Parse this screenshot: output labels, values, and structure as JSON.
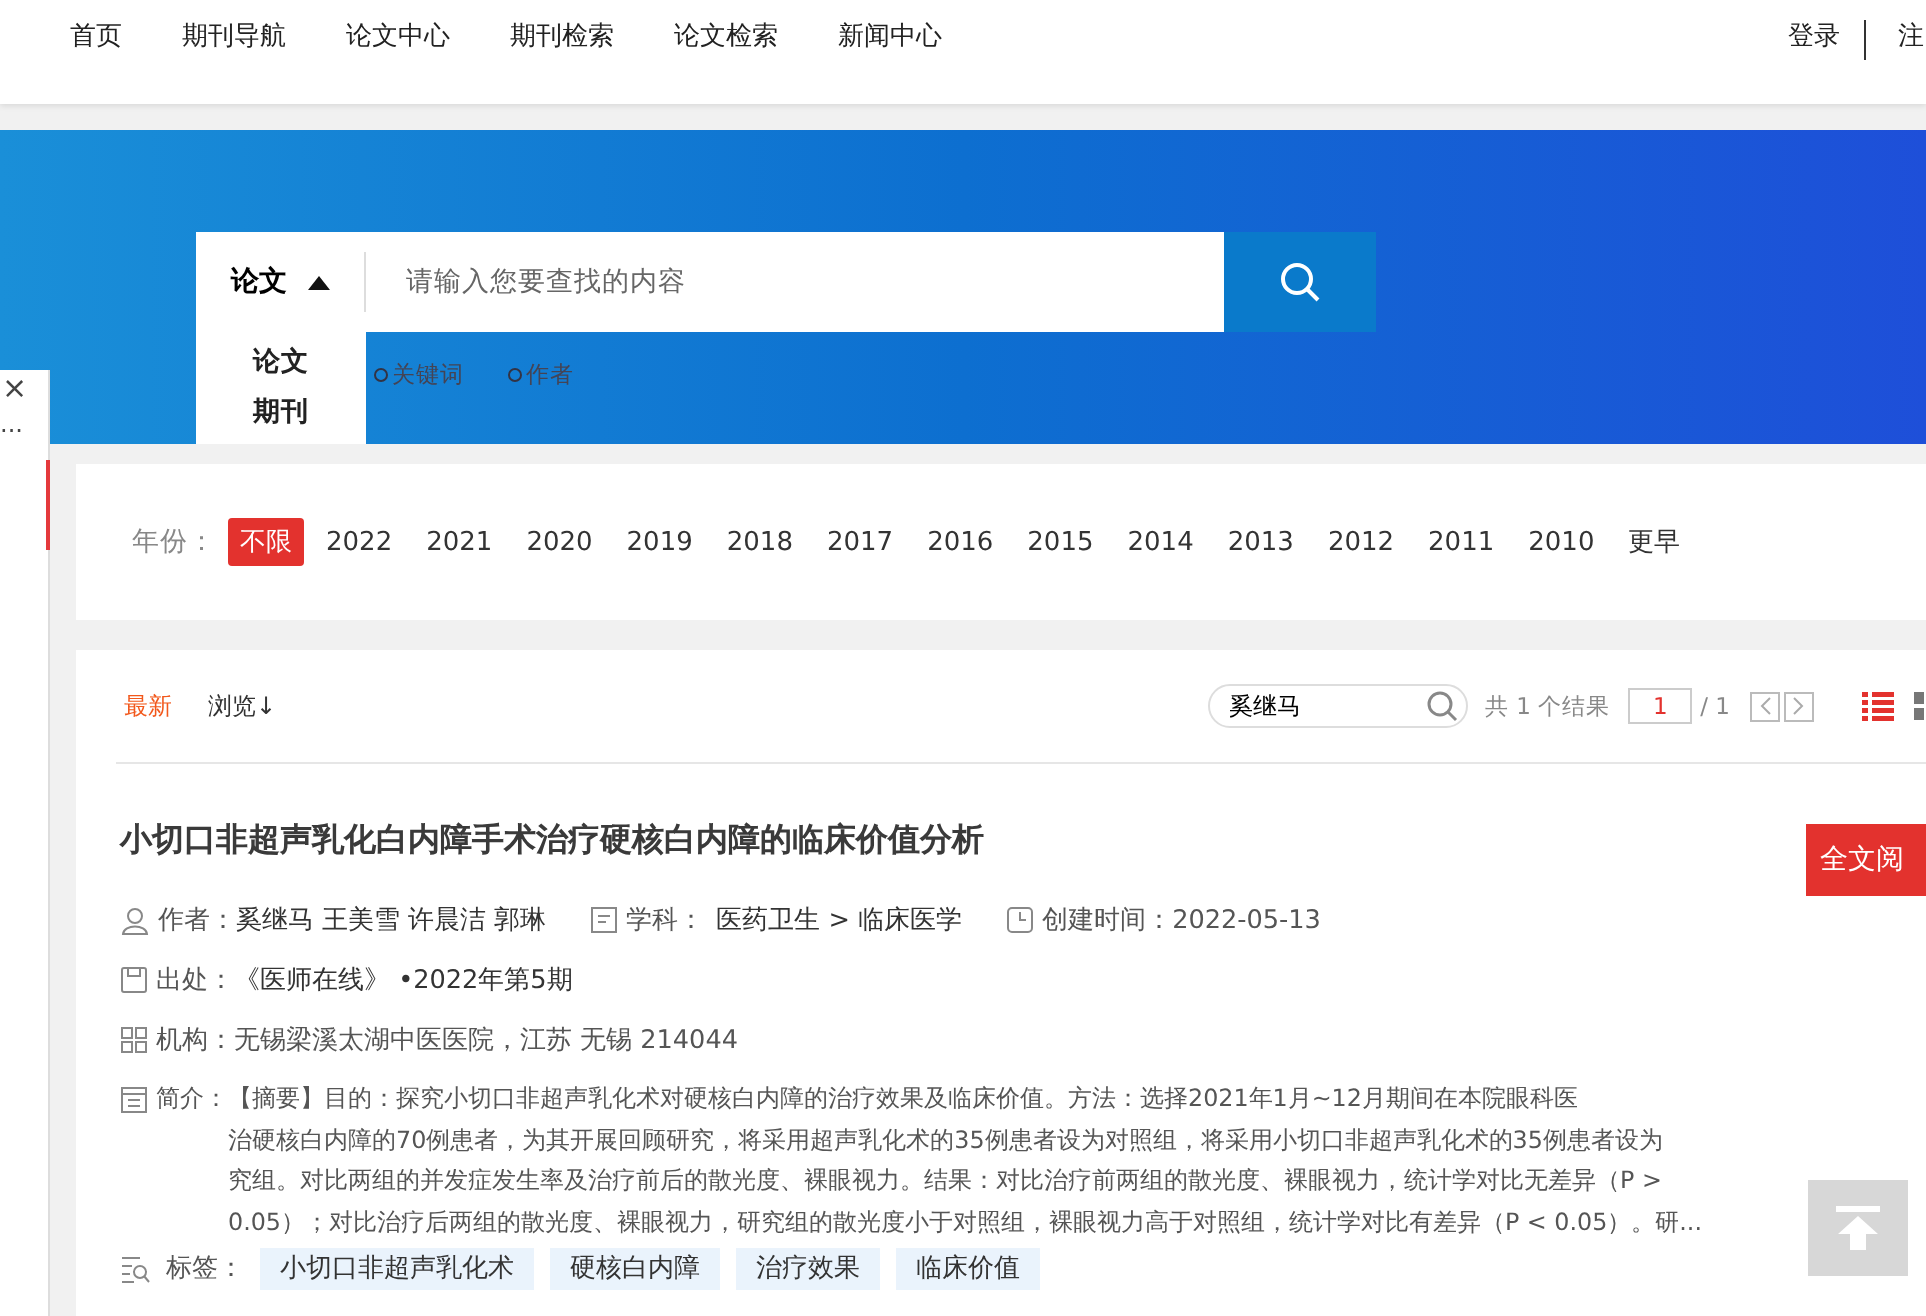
{
  "nav": {
    "items": [
      "首页",
      "期刊导航",
      "论文中心",
      "期刊检索",
      "论文检索",
      "新闻中心"
    ],
    "login": "登录",
    "register": "注"
  },
  "search": {
    "type": "论文",
    "placeholder": "请输入您要查找的内容",
    "options": [
      "论文",
      "期刊"
    ],
    "fields": [
      {
        "label": "关键词",
        "selected": false
      },
      {
        "label": "作者",
        "selected": false
      }
    ]
  },
  "side_panel": {
    "close": "×",
    "more": "..."
  },
  "year_filter": {
    "label": "年份：",
    "years": [
      {
        "label": "不限",
        "selected": true
      },
      {
        "label": "2022",
        "selected": false
      },
      {
        "label": "2021",
        "selected": false
      },
      {
        "label": "2020",
        "selected": false
      },
      {
        "label": "2019",
        "selected": false
      },
      {
        "label": "2018",
        "selected": false
      },
      {
        "label": "2017",
        "selected": false
      },
      {
        "label": "2016",
        "selected": false
      },
      {
        "label": "2015",
        "selected": false
      },
      {
        "label": "2014",
        "selected": false
      },
      {
        "label": "2013",
        "selected": false
      },
      {
        "label": "2012",
        "selected": false
      },
      {
        "label": "2011",
        "selected": false
      },
      {
        "label": "2010",
        "selected": false
      },
      {
        "label": "更早",
        "selected": false
      }
    ]
  },
  "results": {
    "sorts": [
      {
        "label": "最新",
        "selected": true
      },
      {
        "label": "浏览↓",
        "selected": false
      }
    ],
    "filter_value": "奚继马",
    "count": "共 1 个结果",
    "page": "1",
    "pages": "/ 1",
    "article": {
      "title": "小切口非超声乳化白内障手术治疗硬核白内障的临床价值分析",
      "author_label": "作者：",
      "authors": "奚继马 王美雪 许晨洁 郭琳",
      "subject_label": "学科：",
      "subject": "医药卫生 > 临床医学",
      "created": "创建时间：2022-05-13",
      "source_label": "出处：",
      "source": "《医师在线》 •2022年第5期",
      "org": "机构：无锡梁溪太湖中医医院，江苏 无锡 214044",
      "abstract_label": "简介：",
      "abstract_lines": [
        "【摘要】目的：探究小切口非超声乳化术对硬核白内障的治疗效果及临床价值。方法：选择2021年1月~12月期间在本院眼科医",
        "治硬核白内障的70例患者，为其开展回顾研究，将采用超声乳化术的35例患者设为对照组，将采用小切口非超声乳化术的35例患者设为",
        "究组。对比两组的并发症发生率及治疗前后的散光度、裸眼视力。结果：对比治疗前两组的散光度、裸眼视力，统计学对比无差异（P >",
        "0.05）；对比治疗后两组的散光度、裸眼视力，研究组的散光度小于对照组，裸眼视力高于对照组，统计学对比有差异（P < 0.05）。研..."
      ],
      "tags_label": "标签：",
      "tags": [
        "小切口非超声乳化术",
        "硬核白内障",
        "治疗效果",
        "临床价值"
      ],
      "read_button": "全文阅"
    }
  }
}
